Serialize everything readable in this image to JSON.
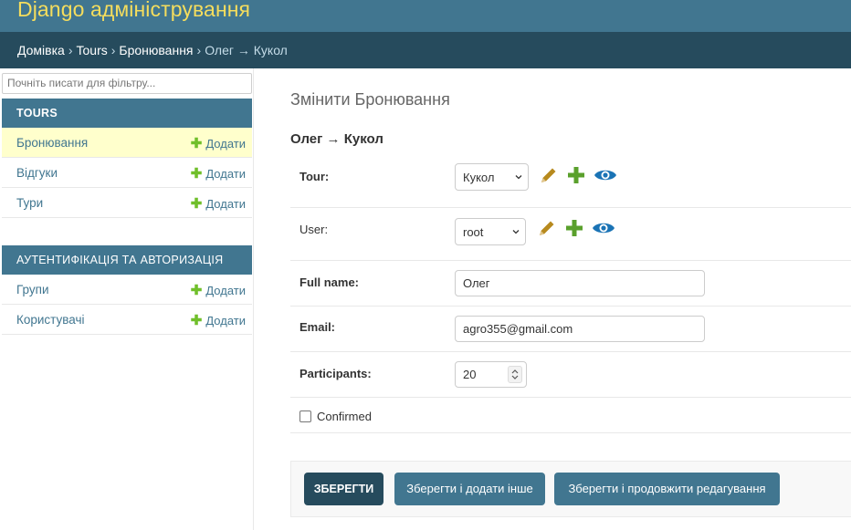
{
  "header": {
    "branding": "Django адміністрування"
  },
  "breadcrumbs": {
    "home": "Домівка",
    "app": "Tours",
    "model": "Бронювання",
    "current": "Олег → Кукол",
    "separator": "›"
  },
  "sidebar": {
    "filter_placeholder": "Почніть писати для фільтру...",
    "add_label": "Додати",
    "modules": [
      {
        "caption": "TOURS",
        "items": [
          "Бронювання",
          "Відгуки",
          "Тури"
        ]
      },
      {
        "caption": "АУТЕНТИФІКАЦІЯ ТА АВТОРИЗАЦІЯ",
        "items": [
          "Групи",
          "Користувачі"
        ]
      }
    ]
  },
  "main": {
    "page_title": "Змінити Бронювання",
    "object_title": "Олег → Кукол",
    "fields": {
      "tour": {
        "label": "Tour:",
        "value": "Кукол"
      },
      "user": {
        "label": "User:",
        "value": "root"
      },
      "full_name": {
        "label": "Full name:",
        "value": "Олег"
      },
      "email": {
        "label": "Email:",
        "value": "agro355@gmail.com"
      },
      "participants": {
        "label": "Participants:",
        "value": "20"
      },
      "confirmed": {
        "label": "Confirmed",
        "checked": false
      }
    },
    "buttons": {
      "save": "ЗБЕРЕГТИ",
      "save_add": "Зберегти і додати інше",
      "save_continue": "Зберегти і продовжити редагування"
    }
  },
  "colors": {
    "header_bg": "#417690",
    "breadcrumbs_bg": "#264b5d",
    "branding": "#f5dd5d",
    "active_row": "#ffffcc",
    "add_plus": "#70bf2b",
    "edit_icon": "#b78a1e",
    "view_icon": "#1a73b5"
  }
}
